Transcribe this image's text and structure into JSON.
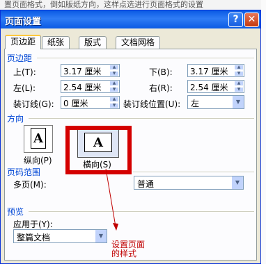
{
  "background_text": "置页面格式，倒如版纸方向，这样点选进行页面格式的设置",
  "dialog": {
    "title": "页面设置",
    "help_label": "?",
    "close_label": "✕"
  },
  "tabs": [
    {
      "label": "页边距",
      "active": true
    },
    {
      "label": "纸张",
      "active": false
    },
    {
      "label": "版式",
      "active": false
    },
    {
      "label": "文档网格",
      "active": false
    }
  ],
  "margins": {
    "heading": "页边距",
    "top_label": "上(T):",
    "top_value": "3.17 厘米",
    "bottom_label": "下(B):",
    "bottom_value": "3.17 厘米",
    "left_label": "左(L):",
    "left_value": "2.54 厘米",
    "right_label": "右(R):",
    "right_value": "2.54 厘米",
    "gutter_label": "装订线(G):",
    "gutter_value": "0 厘米",
    "gutter_pos_label": "装订线位置(U):",
    "gutter_pos_value": "左"
  },
  "orientation": {
    "heading": "方向",
    "portrait_label": "纵向(P)",
    "landscape_label": "横向(S)",
    "icon_letter": "A",
    "selected": "landscape"
  },
  "pages": {
    "heading": "页码范围",
    "multiple_label": "多页(M):",
    "multiple_value": "普通"
  },
  "preview": {
    "heading": "预览",
    "apply_label": "应用于(Y):",
    "apply_value": "整篇文档"
  },
  "annotation": {
    "line1": "设置页面",
    "line2": "的样式",
    "color": "#c00000"
  },
  "colors": {
    "title_bar": "#0a5ae4",
    "section_heading": "#0046d5",
    "highlight_frame": "#d40000",
    "dialog_bg": "#ece9d8"
  }
}
